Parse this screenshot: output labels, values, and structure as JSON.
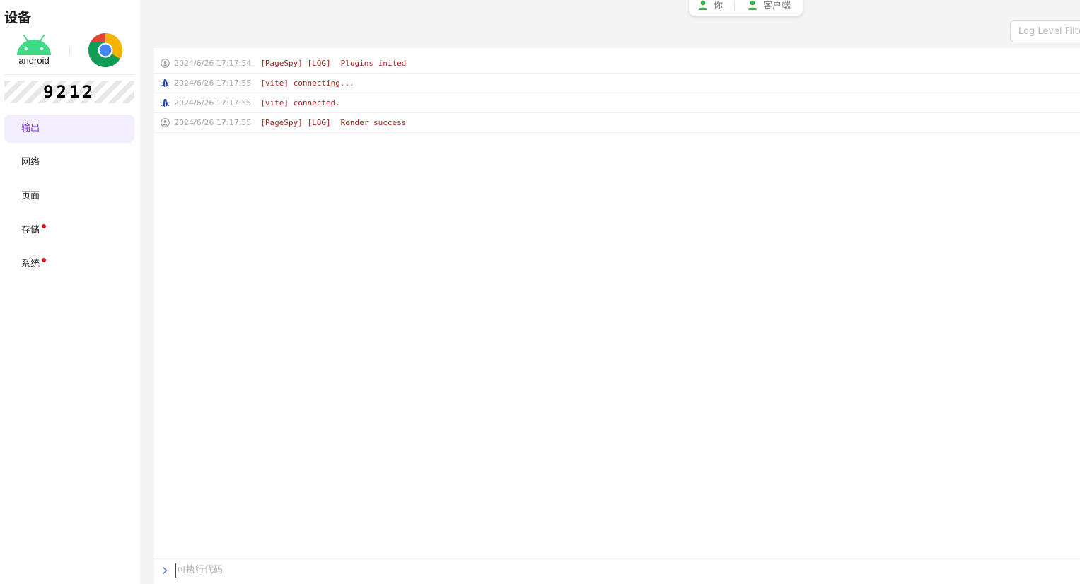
{
  "sidebar": {
    "title": "设备",
    "os_label": "android",
    "device_code": "9212",
    "nav_items": [
      {
        "label": "输出",
        "active": true,
        "badge": false
      },
      {
        "label": "网络",
        "active": false,
        "badge": false
      },
      {
        "label": "页面",
        "active": false,
        "badge": false
      },
      {
        "label": "存储",
        "active": false,
        "badge": true
      },
      {
        "label": "系统",
        "active": false,
        "badge": true
      }
    ]
  },
  "connection": {
    "you_label": "你",
    "client_label": "客户端",
    "status_color": "#3bb54a"
  },
  "filter": {
    "placeholder": "Log Level Filter"
  },
  "logs": [
    {
      "icon": "user-icon",
      "time": "2024/6/26 17:17:54",
      "source": "[PageSpy] [LOG]",
      "text": "Plugins inited"
    },
    {
      "icon": "bug-icon",
      "time": "2024/6/26 17:17:55",
      "source": "[vite] connecting...",
      "text": ""
    },
    {
      "icon": "bug-icon",
      "time": "2024/6/26 17:17:55",
      "source": "[vite] connected.",
      "text": ""
    },
    {
      "icon": "user-icon",
      "time": "2024/6/26 17:17:55",
      "source": "[PageSpy] [LOG]",
      "text": "Render success"
    }
  ],
  "command": {
    "placeholder": "可执行代码"
  },
  "colors": {
    "accent": "#7a2cd6",
    "active_bg": "#f3eefd",
    "log_text": "#a5211e",
    "badge": "#e0141e",
    "android_green": "#3ddc84"
  }
}
